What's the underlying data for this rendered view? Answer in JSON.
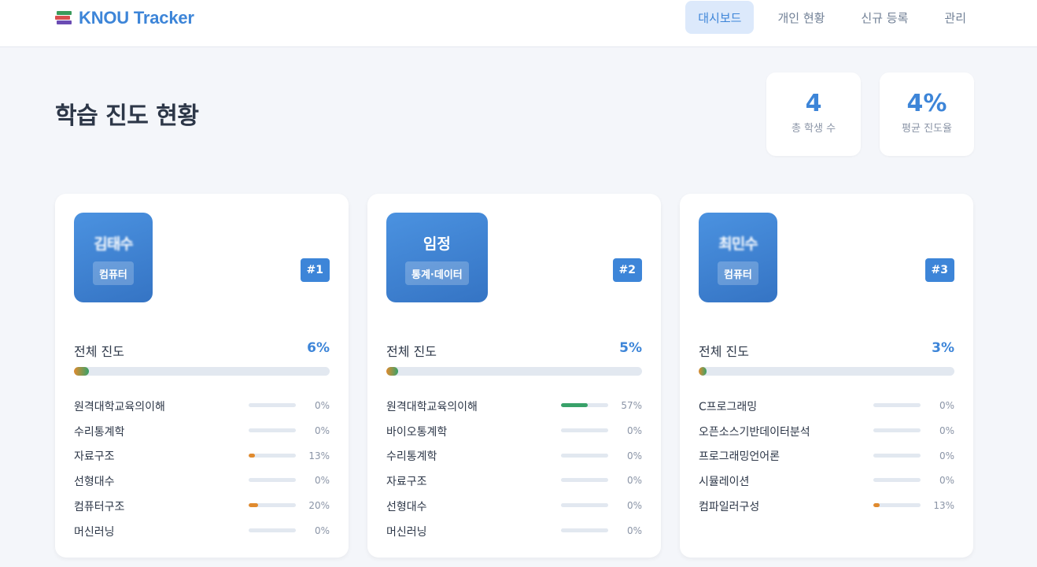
{
  "app": {
    "title": "KNOU Tracker"
  },
  "nav": {
    "items": [
      {
        "label": "대시보드",
        "active": true
      },
      {
        "label": "개인 현황",
        "active": false
      },
      {
        "label": "신규 등록",
        "active": false
      },
      {
        "label": "관리",
        "active": false
      }
    ]
  },
  "page": {
    "title": "학습 진도 현황"
  },
  "stats": [
    {
      "value": "4",
      "label": "총 학생 수"
    },
    {
      "value": "4%",
      "label": "평균 진도율"
    }
  ],
  "overall_label": "전체 진도",
  "colors": {
    "accent": "#3d85d8",
    "progress_green": "#38a169",
    "progress_orange": "#e08a2e",
    "track": "#e2e8f0"
  },
  "students": [
    {
      "name": "김태수",
      "name_obscured": true,
      "major": "컴퓨터",
      "rank": "#1",
      "overall_pct": "6%",
      "overall_value": 6,
      "courses": [
        {
          "name": "원격대학교육의이해",
          "pct": "0%",
          "value": 0
        },
        {
          "name": "수리통계학",
          "pct": "0%",
          "value": 0
        },
        {
          "name": "자료구조",
          "pct": "13%",
          "value": 13
        },
        {
          "name": "선형대수",
          "pct": "0%",
          "value": 0
        },
        {
          "name": "컴퓨터구조",
          "pct": "20%",
          "value": 20
        },
        {
          "name": "머신러닝",
          "pct": "0%",
          "value": 0
        }
      ]
    },
    {
      "name": "임정",
      "name_obscured": false,
      "major": "통계·데이터",
      "rank": "#2",
      "overall_pct": "5%",
      "overall_value": 5,
      "courses": [
        {
          "name": "원격대학교육의이해",
          "pct": "57%",
          "value": 57
        },
        {
          "name": "바이오통계학",
          "pct": "0%",
          "value": 0
        },
        {
          "name": "수리통계학",
          "pct": "0%",
          "value": 0
        },
        {
          "name": "자료구조",
          "pct": "0%",
          "value": 0
        },
        {
          "name": "선형대수",
          "pct": "0%",
          "value": 0
        },
        {
          "name": "머신러닝",
          "pct": "0%",
          "value": 0
        }
      ]
    },
    {
      "name": "최민수",
      "name_obscured": true,
      "major": "컴퓨터",
      "rank": "#3",
      "overall_pct": "3%",
      "overall_value": 3,
      "courses": [
        {
          "name": "C프로그래밍",
          "pct": "0%",
          "value": 0
        },
        {
          "name": "오픈소스기반데이터분석",
          "pct": "0%",
          "value": 0
        },
        {
          "name": "프로그래밍언어론",
          "pct": "0%",
          "value": 0
        },
        {
          "name": "시뮬레이션",
          "pct": "0%",
          "value": 0
        },
        {
          "name": "컴파일러구성",
          "pct": "13%",
          "value": 13
        }
      ]
    }
  ]
}
